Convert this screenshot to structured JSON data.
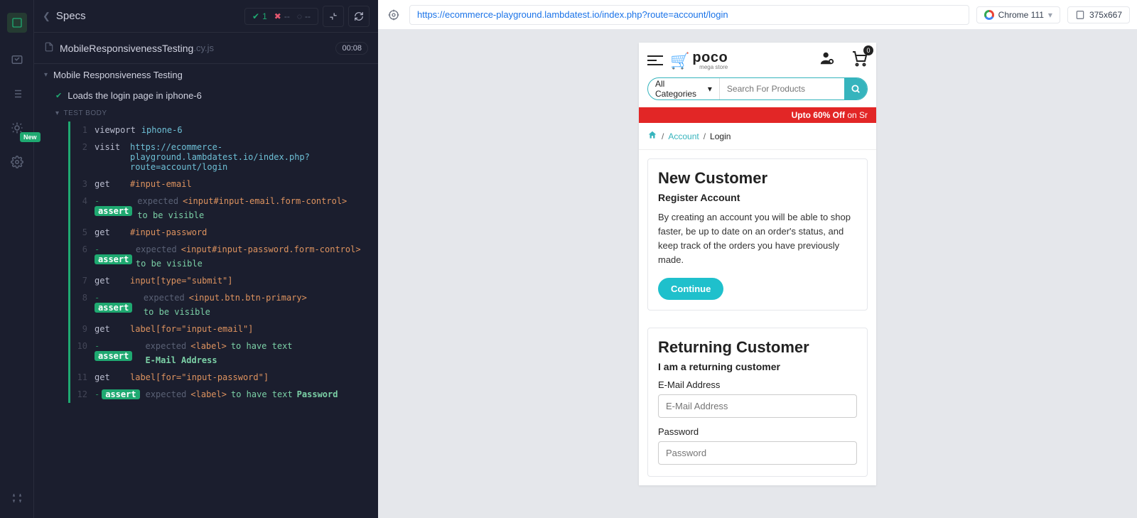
{
  "siderail": {
    "badge": "New"
  },
  "cypress": {
    "header_title": "Specs",
    "pass_count": "1",
    "fail_count": "--",
    "dur": "--",
    "file_name": "MobileResponsivenessTesting",
    "file_ext": ".cy.js",
    "file_time": "00:08",
    "suite_name": "Mobile Responsiveness Testing",
    "test_name": "Loads the login page in iphone-6",
    "body_label": "TEST BODY",
    "rows": [
      {
        "ln": "1",
        "cmd": "viewport",
        "parts": [
          {
            "c": "arg",
            "t": "iphone-6"
          }
        ]
      },
      {
        "ln": "2",
        "cmd": "visit",
        "parts": [
          {
            "c": "arg",
            "t": "https://ecommerce-playground.lambdatest.io/index.php?route=account/login"
          }
        ]
      },
      {
        "ln": "3",
        "cmd": "get",
        "parts": [
          {
            "c": "sel",
            "t": "#input-email"
          }
        ]
      },
      {
        "ln": "4",
        "cmd": "-assert",
        "parts": [
          {
            "t": "expected"
          },
          {
            "c": "sel",
            "t": "<input#input-email.form-control>"
          },
          {
            "c": "kw",
            "t": "to be visible"
          }
        ]
      },
      {
        "ln": "5",
        "cmd": "get",
        "parts": [
          {
            "c": "sel",
            "t": "#input-password"
          }
        ]
      },
      {
        "ln": "6",
        "cmd": "-assert",
        "parts": [
          {
            "t": "expected"
          },
          {
            "c": "sel",
            "t": "<input#input-password.form-control>"
          },
          {
            "c": "kw",
            "t": "to be visible"
          }
        ]
      },
      {
        "ln": "7",
        "cmd": "get",
        "parts": [
          {
            "c": "sel",
            "t": "input[type=\"submit\"]"
          }
        ]
      },
      {
        "ln": "8",
        "cmd": "-assert",
        "parts": [
          {
            "t": "expected"
          },
          {
            "c": "sel",
            "t": "<input.btn.btn-primary>"
          },
          {
            "c": "kw",
            "t": "to be visible"
          }
        ]
      },
      {
        "ln": "9",
        "cmd": "get",
        "parts": [
          {
            "c": "sel",
            "t": "label[for=\"input-email\"]"
          }
        ]
      },
      {
        "ln": "10",
        "cmd": "-assert",
        "parts": [
          {
            "t": "expected"
          },
          {
            "c": "sel",
            "t": "<label>"
          },
          {
            "c": "kw",
            "t": "to have text"
          },
          {
            "c": "val",
            "t": "E-Mail Address"
          }
        ]
      },
      {
        "ln": "11",
        "cmd": "get",
        "parts": [
          {
            "c": "sel",
            "t": "label[for=\"input-password\"]"
          }
        ]
      },
      {
        "ln": "12",
        "cmd": "-assert",
        "parts": [
          {
            "t": "expected"
          },
          {
            "c": "sel",
            "t": "<label>"
          },
          {
            "c": "kw",
            "t": "to have text"
          },
          {
            "c": "val",
            "t": "Password"
          }
        ]
      }
    ]
  },
  "browser": {
    "url": "https://ecommerce-playground.lambdatest.io/index.php?route=account/login",
    "chrome_label": "Chrome 111",
    "dims": "375x667"
  },
  "store": {
    "logo_name": "poco",
    "logo_sub": "mega store",
    "cart_count": "0",
    "cat_label": "All Categories",
    "search_placeholder": "Search For Products",
    "banner_off": "Upto 60% Off",
    "banner_rest": "on Sr",
    "crumb_account": "Account",
    "crumb_login": "Login",
    "new_title": "New Customer",
    "new_sub": "Register Account",
    "new_body": "By creating an account you will be able to shop faster, be up to date on an order's status, and keep track of the orders you have previously made.",
    "continue": "Continue",
    "ret_title": "Returning Customer",
    "ret_sub": "I am a returning customer",
    "email_label": "E-Mail Address",
    "email_placeholder": "E-Mail Address",
    "pass_label": "Password",
    "pass_placeholder": "Password"
  }
}
